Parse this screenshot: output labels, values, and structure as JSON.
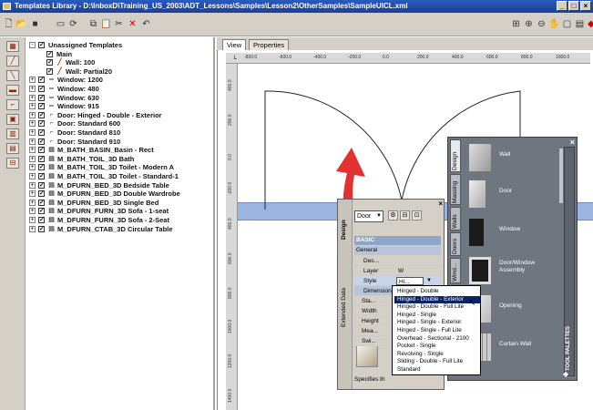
{
  "window": {
    "title": "Templates Library - D:\\InboxD\\Training_US_2003\\ADT_Lessons\\Samples\\Lesson2\\OtherSamples\\SampleUICL.xml",
    "buttons": [
      "_",
      "□",
      "×"
    ]
  },
  "tree": {
    "rows": [
      {
        "label": "Unassigned Templates",
        "level": 0,
        "expander": "-",
        "icon": ""
      },
      {
        "label": "Main",
        "level": 1,
        "expander": "",
        "icon": ""
      },
      {
        "label": "Wall: 100",
        "level": 1,
        "expander": "",
        "icon": "pencil"
      },
      {
        "label": "Wall: Partial20",
        "level": 1,
        "expander": "",
        "icon": "pencil"
      },
      {
        "label": "Window: 1200",
        "level": 0,
        "expander": "+",
        "icon": "window"
      },
      {
        "label": "Window: 480",
        "level": 0,
        "expander": "+",
        "icon": "window"
      },
      {
        "label": "Window: 630",
        "level": 0,
        "expander": "+",
        "icon": "window"
      },
      {
        "label": "Window: 915",
        "level": 0,
        "expander": "+",
        "icon": "window"
      },
      {
        "label": "Door: Hinged - Double - Exterior",
        "level": 0,
        "expander": "+",
        "icon": "door"
      },
      {
        "label": "Door: Standard 600",
        "level": 0,
        "expander": "+",
        "icon": "door"
      },
      {
        "label": "Door: Standard 810",
        "level": 0,
        "expander": "+",
        "icon": "door"
      },
      {
        "label": "Door: Standard 910",
        "level": 0,
        "expander": "+",
        "icon": "door"
      },
      {
        "label": "M_BATH_BASIN_Basin - Rect",
        "level": 0,
        "expander": "+",
        "icon": "block"
      },
      {
        "label": "M_BATH_TOIL_3D Bath",
        "level": 0,
        "expander": "+",
        "icon": "block"
      },
      {
        "label": "M_BATH_TOIL_3D Toilet - Modern A",
        "level": 0,
        "expander": "+",
        "icon": "block"
      },
      {
        "label": "M_BATH_TOIL_3D Toilet - Standard-1",
        "level": 0,
        "expander": "+",
        "icon": "block"
      },
      {
        "label": "M_DFURN_BED_3D Bedside Table",
        "level": 0,
        "expander": "+",
        "icon": "block"
      },
      {
        "label": "M_DFURN_BED_3D Double Wardrobe",
        "level": 0,
        "expander": "+",
        "icon": "block"
      },
      {
        "label": "M_DFURN_BED_3D Single Bed",
        "level": 0,
        "expander": "+",
        "icon": "block"
      },
      {
        "label": "M_DFURN_FURN_3D Sofa - 1-seat",
        "level": 0,
        "expander": "+",
        "icon": "block"
      },
      {
        "label": "M_DFURN_FURN_3D Sofa - 2-Seat",
        "level": 0,
        "expander": "+",
        "icon": "block"
      },
      {
        "label": "M_DFURN_CTAB_3D Circular Table",
        "level": 0,
        "expander": "+",
        "icon": "block"
      }
    ]
  },
  "tabs": [
    {
      "label": "View"
    },
    {
      "label": "Properties"
    }
  ],
  "ruler": {
    "h_ticks": [
      "-800.0",
      "-600.0",
      "-400.0",
      "-200.0",
      "0.0",
      "200.0",
      "400.0",
      "600.0",
      "800.0",
      "1000.0"
    ],
    "v_ticks": [
      "400.0",
      "200.0",
      "0.0",
      "-200.0",
      "400.0",
      "600.0",
      "800.0",
      "1000.0",
      "1200.0",
      "1400.0"
    ]
  },
  "palette": {
    "tabs": [
      "Design",
      "Massing",
      "Walls",
      "Doors",
      "Wind..."
    ],
    "items": [
      {
        "label": "Wall"
      },
      {
        "label": "Door"
      },
      {
        "label": "Window"
      },
      {
        "label": "Door/Window Assembly"
      },
      {
        "label": "Opening"
      },
      {
        "label": "Curtain Wall"
      }
    ],
    "side_label": "TOOL PALETTES",
    "close": "×"
  },
  "props": {
    "object_type": "Door",
    "side_tabs": [
      "Design",
      "Extended Data"
    ],
    "section_basic": "BASIC",
    "section_general": "General",
    "rows": [
      {
        "label": "Des...",
        "value": ""
      },
      {
        "label": "Layer",
        "value": "W"
      },
      {
        "label": "Style",
        "value": "Hi..."
      },
      {
        "label": "Dimension",
        "value": ""
      },
      {
        "label": "Sta...",
        "value": ""
      },
      {
        "label": "Width",
        "value": ""
      },
      {
        "label": "Height",
        "value": ""
      },
      {
        "label": "Mea...",
        "value": ""
      },
      {
        "label": "Swi...",
        "value": ""
      }
    ],
    "footer": "Specifies th",
    "close": "×"
  },
  "dropdown": {
    "items": [
      "Hinged - Double",
      "Hinged - Double - Exterior",
      "Hinged - Double - Full Lite",
      "Hinged - Single",
      "Hinged - Single - Exterior",
      "Hinged - Single - Full Lite",
      "Overhead - Sectional - 2100",
      "Pocket - Single",
      "Revolving - Single",
      "Sliding - Double - Full Lite",
      "Standard"
    ],
    "selected_index": 1
  },
  "colors": {
    "titlebar": "#1c3f94",
    "wall_band": "#9bb5e0",
    "arrow": "#e02020",
    "palette_bg": "#6f7680",
    "selection": "#0a246a"
  }
}
